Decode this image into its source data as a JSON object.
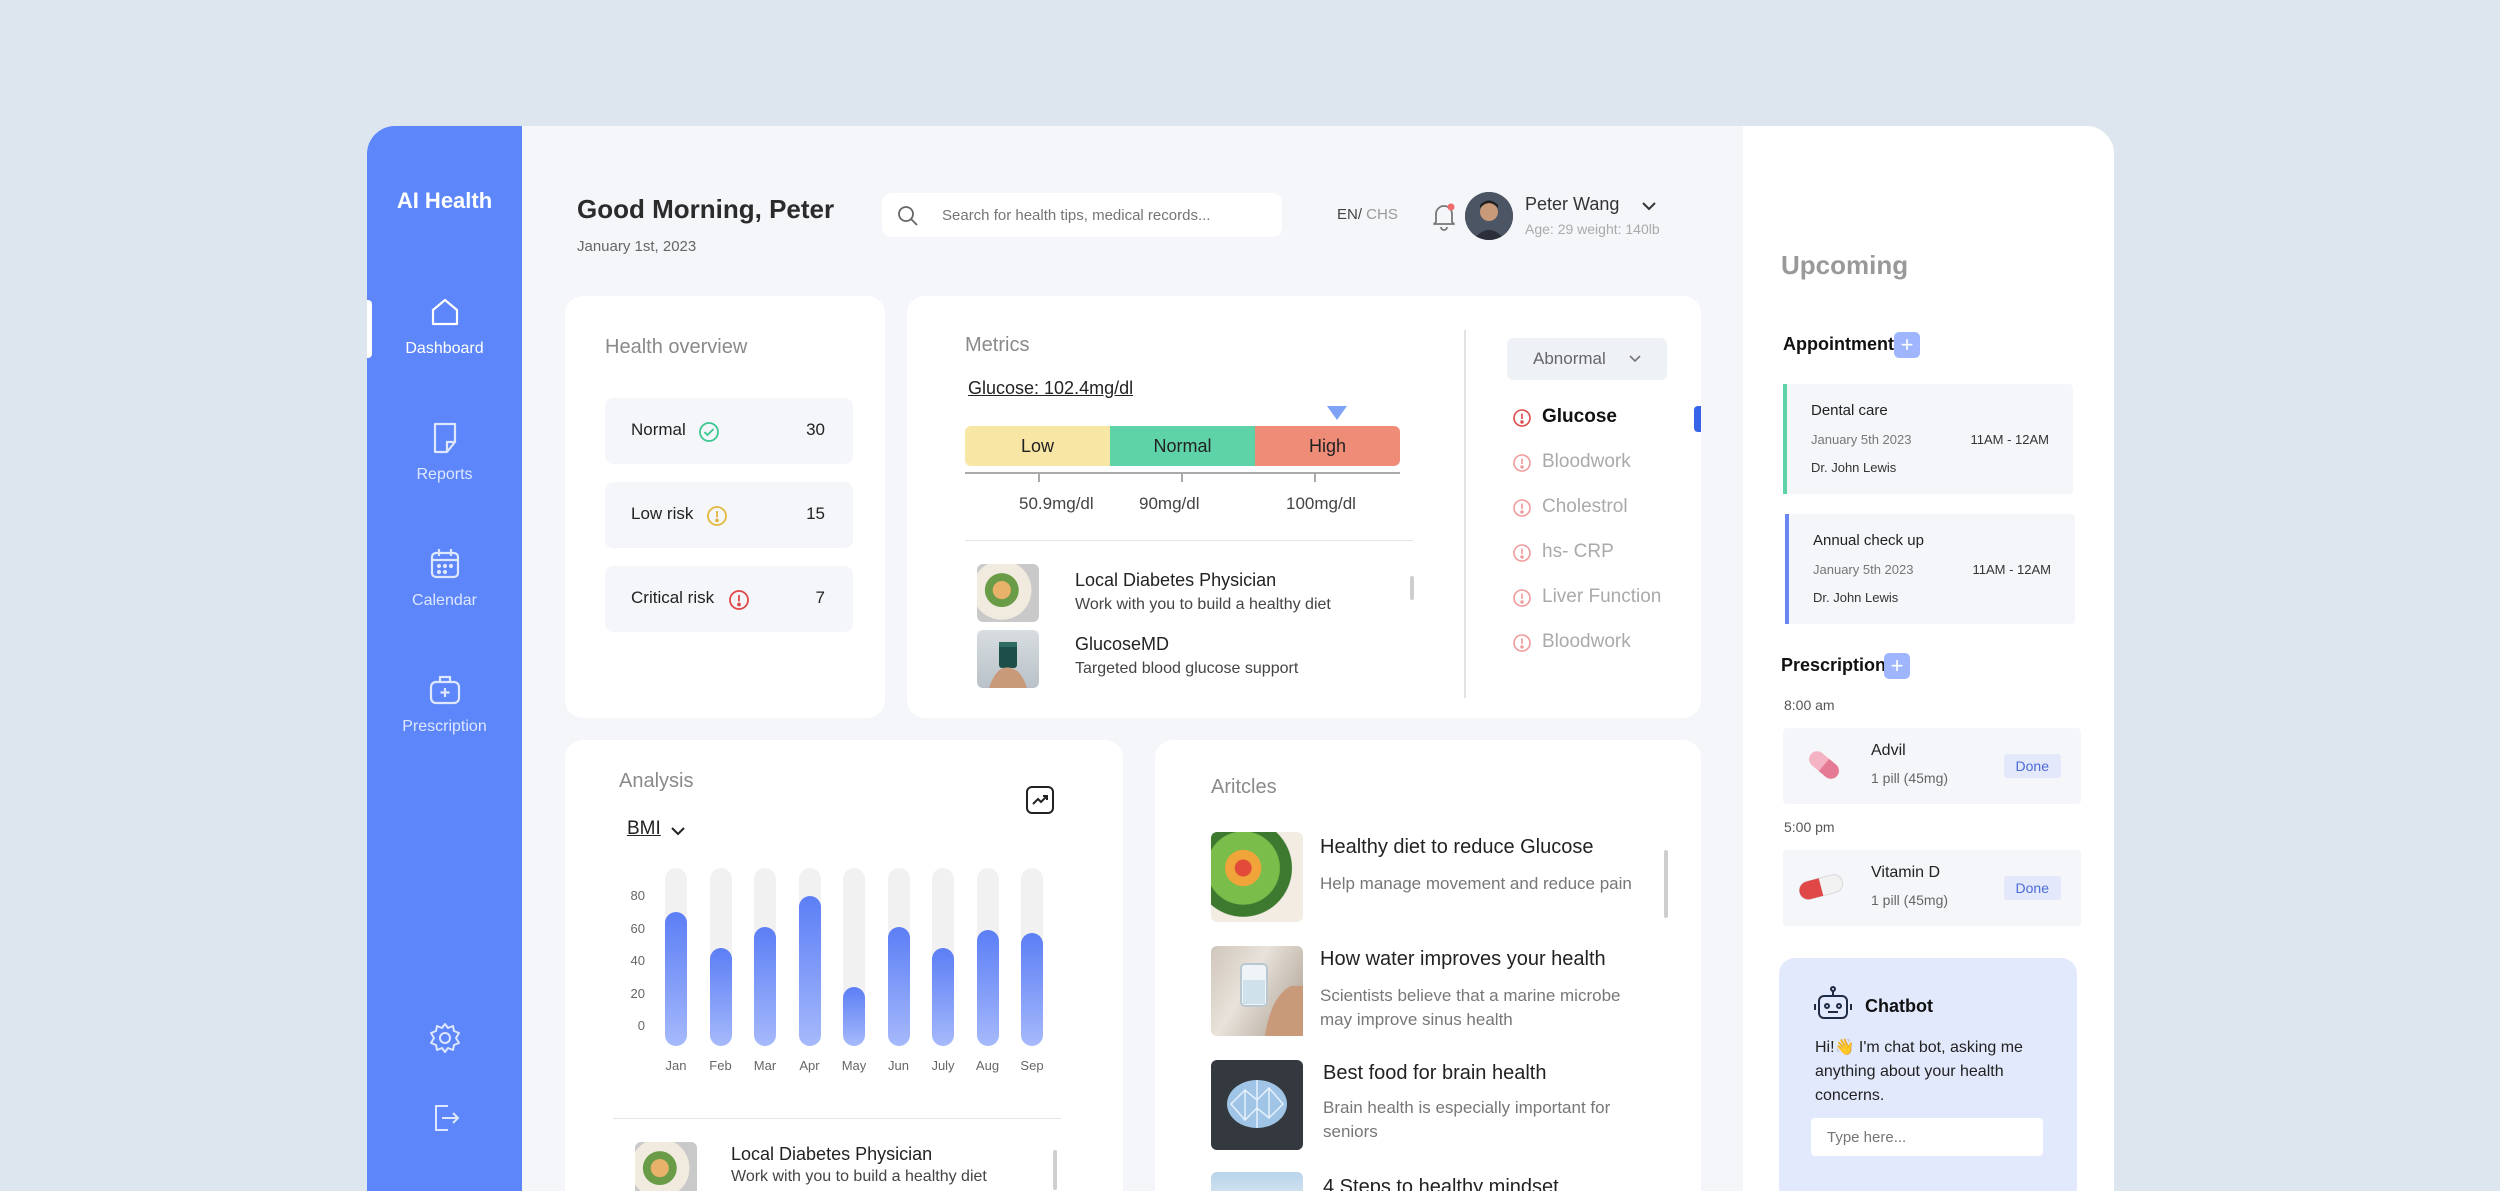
{
  "app": {
    "name": "AI Health"
  },
  "sidebar": {
    "items": [
      {
        "label": "Dashboard",
        "icon": "home-icon"
      },
      {
        "label": "Reports",
        "icon": "report-icon"
      },
      {
        "label": "Calendar",
        "icon": "calendar-icon"
      },
      {
        "label": "Prescription",
        "icon": "medkit-icon"
      }
    ]
  },
  "header": {
    "greeting": "Good Morning, Peter",
    "date": "January 1st, 2023",
    "search_placeholder": "Search for health tips, medical records...",
    "lang_active": "EN/",
    "lang_other": " CHS",
    "user_name": "Peter Wang",
    "user_meta": "Age: 29  weight: 140lb"
  },
  "health_overview": {
    "title": "Health overview",
    "rows": [
      {
        "label": "Normal",
        "count": "30"
      },
      {
        "label": "Low risk",
        "count": "15"
      },
      {
        "label": "Critical risk",
        "count": "7"
      }
    ]
  },
  "metrics": {
    "title": "Metrics",
    "reading": "Glucose: 102.4mg/dl",
    "ranges": [
      "Low",
      "Normal",
      "High"
    ],
    "ticks": [
      "50.9mg/dl",
      "90mg/dl",
      "100mg/dl"
    ],
    "recommendations": [
      {
        "name": "Local Diabetes Physician",
        "desc": "Work with you to build a healthy diet"
      },
      {
        "name": "GlucoseMD",
        "desc": "Targeted blood glucose support"
      }
    ],
    "filter": "Abnormal",
    "list": [
      "Glucose",
      "Bloodwork",
      "Cholestrol",
      "hs- CRP",
      "Liver Function",
      "Bloodwork"
    ]
  },
  "analysis": {
    "title": "Analysis",
    "selector": "BMI",
    "footer": {
      "name": "Local Diabetes Physician",
      "desc": "Work with you to build a healthy diet"
    }
  },
  "chart_data": {
    "type": "bar",
    "categories": [
      "Jan",
      "Feb",
      "Mar",
      "Apr",
      "May",
      "Jun",
      "July",
      "Aug",
      "Sep"
    ],
    "values": [
      70,
      48,
      61,
      80,
      24,
      61,
      48,
      59,
      57
    ],
    "yticks": [
      "80",
      "60",
      "40",
      "20",
      "0"
    ],
    "ylim": [
      0,
      80
    ],
    "title": "",
    "xlabel": "",
    "ylabel": "BMI"
  },
  "articles": {
    "title": "Aritcles",
    "items": [
      {
        "title": "Healthy diet to reduce Glucose",
        "desc": "Help manage movement and reduce pain"
      },
      {
        "title": "How water improves your health",
        "desc": "Scientists believe that a marine microbe may improve sinus health"
      },
      {
        "title": "Best food for brain health",
        "desc": "Brain health is especially important for seniors"
      },
      {
        "title": "4 Steps to healthy mindset",
        "desc": ""
      }
    ]
  },
  "upcoming": {
    "title": "Upcoming",
    "appointment_label": "Appointment",
    "appointments": [
      {
        "title": "Dental care",
        "date": "January 5th 2023",
        "time": "11AM - 12AM",
        "doctor": "Dr. John Lewis",
        "color": "#5fd3a8"
      },
      {
        "title": "Annual check up",
        "date": "January 5th 2023",
        "time": "11AM - 12AM",
        "doctor": "Dr. John Lewis",
        "color": "#6a86f0"
      }
    ],
    "prescription_label": "Prescription",
    "prescriptions": [
      {
        "time": "8:00 am",
        "name": "Advil",
        "dose": "1 pill (45mg)",
        "status": "Done"
      },
      {
        "time": "5:00 pm",
        "name": "Vitamin D",
        "dose": "1 pill (45mg)",
        "status": "Done"
      }
    ]
  },
  "chatbot": {
    "title": "Chatbot",
    "message": "Hi!👋 I'm chat bot, asking me anything about your health concerns.",
    "placeholder": "Type here..."
  },
  "colors": {
    "accent": "#5c86f9",
    "low": "#f7e6a4",
    "normal": "#5fd3a8",
    "high": "#ef8c78"
  }
}
